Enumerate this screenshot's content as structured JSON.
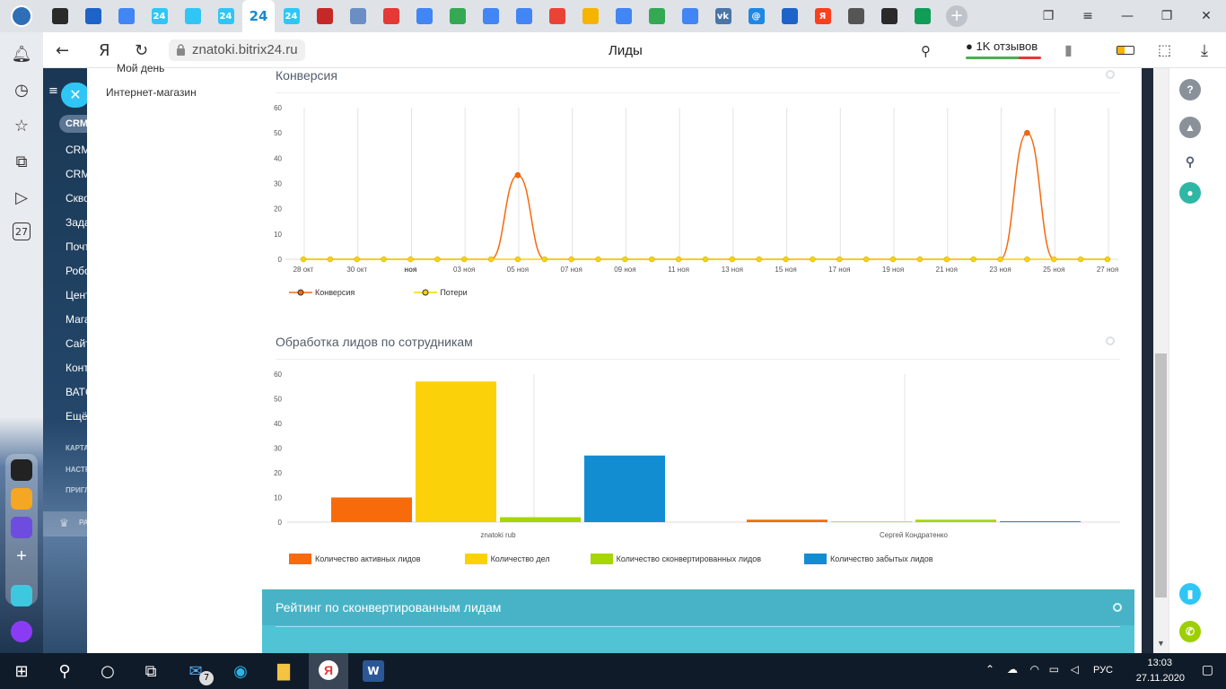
{
  "browser": {
    "url": "znatoki.bitrix24.ru",
    "page_title": "Лиды",
    "reviews_label": "1K отзывов",
    "tabs": [
      {
        "icon": "back-circle-icon",
        "color": "#2a2a2a"
      },
      {
        "icon": "mail-icon",
        "color": "#1e63c7"
      },
      {
        "icon": "docs-icon",
        "color": "#4285f4"
      },
      {
        "icon": "bitrix24-icon",
        "label": "24",
        "color": "#2fc6f6"
      },
      {
        "icon": "star-burst-icon",
        "color": "#2fc6f6"
      },
      {
        "icon": "bitrix24-icon",
        "label": "24",
        "color": "#2fc6f6"
      },
      {
        "icon": "bitrix24-icon",
        "label": "24",
        "color": "#2fc6f6",
        "active": true
      },
      {
        "icon": "bitrix24-icon",
        "label": "24",
        "color": "#2fc6f6"
      },
      {
        "icon": "b-icon",
        "color": "#c62828"
      },
      {
        "icon": "flag-icon",
        "color": "#6b8fc4"
      },
      {
        "icon": "link-icon",
        "color": "#e53935"
      },
      {
        "icon": "docs-icon",
        "color": "#4285f4"
      },
      {
        "icon": "drive-icon",
        "color": "#34a853"
      },
      {
        "icon": "docs-icon",
        "color": "#4285f4"
      },
      {
        "icon": "docs-icon",
        "color": "#4285f4"
      },
      {
        "icon": "gmail-icon",
        "color": "#ea4335"
      },
      {
        "icon": "ball-icon",
        "color": "#f4b400"
      },
      {
        "icon": "docs-icon",
        "color": "#4285f4"
      },
      {
        "icon": "drive-icon",
        "color": "#34a853"
      },
      {
        "icon": "docs-icon",
        "color": "#4285f4"
      },
      {
        "icon": "vk-icon",
        "label": "vk",
        "color": "#4a76a8"
      },
      {
        "icon": "at-icon",
        "label": "@",
        "color": "#1e88e5"
      },
      {
        "icon": "mail-icon",
        "color": "#1e63c7"
      },
      {
        "icon": "yandex-icon",
        "label": "Я",
        "color": "#fc3f1d"
      },
      {
        "icon": "gear-icon",
        "color": "#555"
      },
      {
        "icon": "back-circle-icon",
        "color": "#2a2a2a"
      },
      {
        "icon": "plus-green-icon",
        "color": "#0f9d58"
      }
    ]
  },
  "crm_nav": {
    "badge": "CRM",
    "items": [
      "CRM",
      "CRM",
      "Скво",
      "Зада",
      "Почт",
      "Робо",
      "Цент",
      "Мага",
      "Сайт",
      "Конт",
      "ВАТС",
      "Ещё"
    ],
    "small": [
      "КАРТА",
      "НАСТР",
      "ПРИГЛ"
    ],
    "footer": "РА"
  },
  "submenu": {
    "top_cut": "Мой день",
    "item": "Интернет-магазин"
  },
  "conversion": {
    "title": "Конверсия",
    "legend": [
      "Конверсия",
      "Потери"
    ]
  },
  "processing": {
    "title": "Обработка лидов по сотрудникам",
    "legend": [
      "Количество активных лидов",
      "Количество дел",
      "Количество сконвертированных лидов",
      "Количество забытых лидов"
    ]
  },
  "rating": {
    "title": "Рейтинг по сконвертированным лидам"
  },
  "taskbar": {
    "mail_count": "7",
    "lang": "РУС",
    "time": "13:03",
    "date": "27.11.2020"
  },
  "chart_data": [
    {
      "type": "line",
      "title": "Конверсия",
      "x": [
        "28 окт",
        "29 окт",
        "30 окт",
        "31 окт",
        "ноя",
        "02 ноя",
        "03 ноя",
        "04 ноя",
        "05 ноя",
        "06 ноя",
        "07 ноя",
        "08 ноя",
        "09 ноя",
        "10 ноя",
        "11 ноя",
        "12 ноя",
        "13 ноя",
        "14 ноя",
        "15 ноя",
        "16 ноя",
        "17 ноя",
        "18 ноя",
        "19 ноя",
        "20 ноя",
        "21 ноя",
        "22 ноя",
        "23 ноя",
        "24 ноя",
        "25 ноя",
        "26 ноя",
        "27 ноя"
      ],
      "tick_labels": [
        "28 окт",
        "30 окт",
        "ноя",
        "03 ноя",
        "05 ноя",
        "07 ноя",
        "09 ноя",
        "11 ноя",
        "13 ноя",
        "15 ноя",
        "17 ноя",
        "19 ноя",
        "21 ноя",
        "23 ноя",
        "25 ноя",
        "27 ноя"
      ],
      "ylim": [
        0,
        60
      ],
      "yticks": [
        0,
        10,
        20,
        30,
        40,
        50,
        60
      ],
      "series": [
        {
          "name": "Конверсия",
          "color": "#f7680b",
          "values": [
            0,
            0,
            0,
            0,
            0,
            0,
            0,
            0,
            33.3,
            0,
            0,
            0,
            0,
            0,
            0,
            0,
            0,
            0,
            0,
            0,
            0,
            0,
            0,
            0,
            0,
            0,
            0,
            50,
            0,
            0,
            0
          ]
        },
        {
          "name": "Потери",
          "color": "#f7d308",
          "values": [
            0,
            0,
            0,
            0,
            0,
            0,
            0,
            0,
            0,
            0,
            0,
            0,
            0,
            0,
            0,
            0,
            0,
            0,
            0,
            0,
            0,
            0,
            0,
            0,
            0,
            0,
            0,
            0,
            0,
            0,
            0
          ]
        }
      ],
      "legend_position": "bottom-left"
    },
    {
      "type": "bar",
      "title": "Обработка лидов по сотрудникам",
      "categories": [
        "znatoki rub",
        "Сергей Кондратенко"
      ],
      "ylim": [
        0,
        60
      ],
      "yticks": [
        0,
        10,
        20,
        30,
        40,
        50,
        60
      ],
      "series": [
        {
          "name": "Количество активных лидов",
          "color": "#f76b0b",
          "values": [
            10,
            1
          ]
        },
        {
          "name": "Количество дел",
          "color": "#fbd10a",
          "values": [
            57,
            0
          ]
        },
        {
          "name": "Количество сконвертированных лидов",
          "color": "#a6d50a",
          "values": [
            2,
            1
          ]
        },
        {
          "name": "Количество забытых лидов",
          "color": "#138dd2",
          "values": [
            27,
            0
          ]
        }
      ],
      "legend_position": "bottom-left"
    }
  ]
}
